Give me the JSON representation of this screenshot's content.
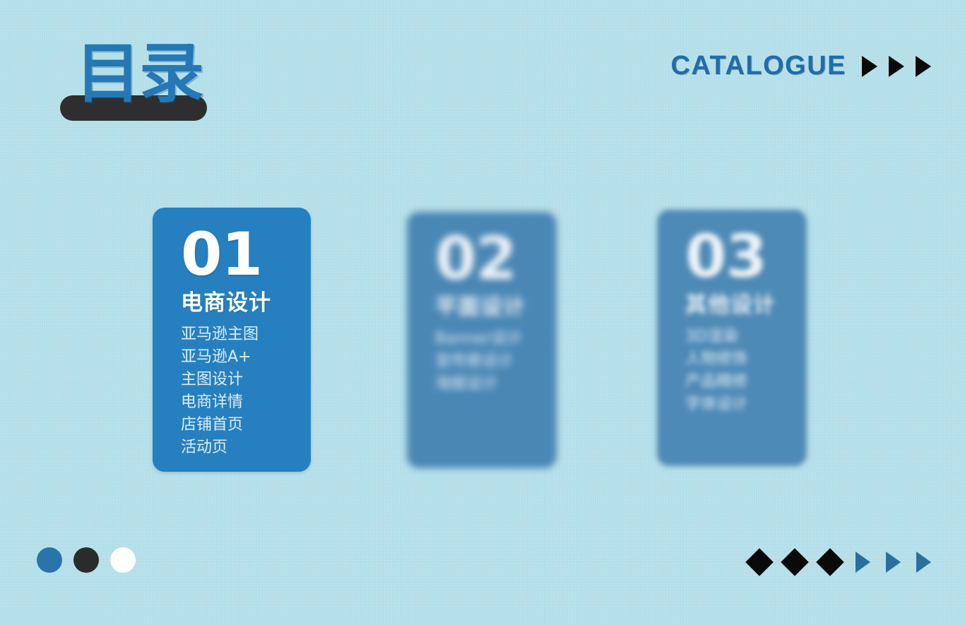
{
  "background": {
    "color": "#b4dfe9",
    "texture": "noise-grain"
  },
  "header": {
    "title_cn": "目录",
    "title_bar_color": "#2e2e30",
    "title_color": "#2478b5",
    "catalogue_label": "CATALOGUE",
    "catalogue_color": "#1f6daa",
    "arrows": [
      {
        "icon": "triangle-right-icon",
        "color": "#0a0a0a"
      },
      {
        "icon": "triangle-right-icon",
        "color": "#0a0a0a"
      },
      {
        "icon": "triangle-right-icon",
        "color": "#0a0a0a"
      }
    ]
  },
  "cards": [
    {
      "number": "01",
      "heading": "电商设计",
      "accent": "#2680bf",
      "focused": true,
      "items": [
        "亚马逊主图",
        "亚马逊A+",
        "主图设计",
        "电商详情",
        "店铺首页",
        "活动页"
      ]
    },
    {
      "number": "02",
      "heading": "平面设计",
      "accent": "#4a87b5",
      "focused": false,
      "items": [
        "Banner设计",
        "宣传册设计",
        "海报设计"
      ]
    },
    {
      "number": "03",
      "heading": "其他设计",
      "accent": "#4e8ab6",
      "focused": false,
      "items": [
        "3D渲染",
        "人物修饰",
        "产品精修",
        "字体设计"
      ]
    }
  ],
  "footer": {
    "dots": [
      {
        "icon": "circle-icon",
        "color": "#2a74ab"
      },
      {
        "icon": "circle-icon",
        "color": "#2b2b2d"
      },
      {
        "icon": "circle-icon",
        "color": "#ffffff"
      }
    ],
    "shapes": [
      {
        "icon": "diamond-icon",
        "color": "#0a0a0a"
      },
      {
        "icon": "diamond-icon",
        "color": "#0a0a0a"
      },
      {
        "icon": "diamond-icon",
        "color": "#0a0a0a"
      },
      {
        "icon": "triangle-right-icon",
        "color": "#2a6f9e"
      },
      {
        "icon": "triangle-right-icon",
        "color": "#2a6f9e"
      },
      {
        "icon": "triangle-right-icon",
        "color": "#2a6f9e"
      }
    ]
  }
}
